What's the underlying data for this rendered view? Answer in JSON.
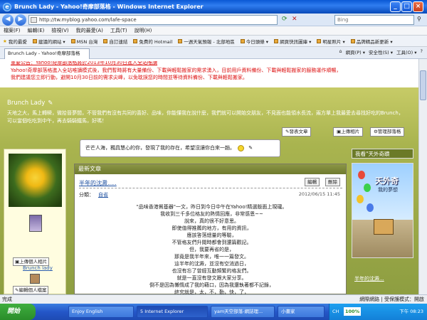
{
  "window": {
    "title": "Brunch Lady - Yahoo!奇摩部落格 - Windows Internet Explorer",
    "minimize": "_",
    "maximize": "□",
    "close": "×"
  },
  "address": {
    "url": "http://tw.myblog.yahoo.com/lafe-space",
    "search_placeholder": "Bing"
  },
  "menu": [
    "檔案(F)",
    "編輯(E)",
    "檢視(V)",
    "我的最愛(A)",
    "工具(T)",
    "說明(H)"
  ],
  "favorites": [
    "我的最愛",
    "建議的網站 ▾",
    "MSN 台灣",
    "自訂連結",
    "免費的 Hotmail",
    "一週天氣預報 - 北部地區",
    "今日頭條 ▾",
    "網頁快訊圖庫 ▾",
    "明星照片 ▾",
    "品牌精品新更新 ▾"
  ],
  "tab": {
    "label": "Brunch Lady - Yahoo!奇摩部落格"
  },
  "tools": [
    "網頁(P) ▾",
    "安全性(S) ▾",
    "工具(O) ▾",
    "?"
  ],
  "notice": {
    "line0": "重要公告：Yahoo!奇摩部落格將於2013年10月30日進入全站唯讀",
    "line1": "Yahoo!奇摩部落格進入全站唯讀模式後，我們暫時將有大量備份、下載與輕鬆搬家的需求湧入，目前用戶資料備份、下載與輕鬆搬家的服務運作順暢，",
    "line2": "我們建議您立即行動，避開10月30日前的需求尖峰，以免耽誤您的時間並等待資料備份、下載與輕鬆搬家。"
  },
  "profile": {
    "blog_title": "Brunch Lady",
    "description": "天地之大，馬上轉瞬，微拾晉夢間，不管我們有沒有共同的喜好、品味，你能懂我在說什麼，我們就可以開始交朋友，不見面也能領水長流，兩方單上我最愛去尋找好吃的Brunch，可以當個吃吃到中午，再去騎騎鐵馬，好嗎！",
    "btn_post": "發表文章",
    "btn_upload": "上傳相片",
    "btn_manage": "管理部落格",
    "bubble": "芒芒人海，獨具慧心的你，發現了我的存在，希望沒讓你白來一趟。"
  },
  "left": {
    "upload_photo": "上傳個人相片",
    "user_link": "Brunch lady",
    "edit_profile": "編輯個人檔案"
  },
  "main": {
    "section_title": "最新文章",
    "post_title": "半年的沈澱.....",
    "edit": "編輯",
    "delete": "刪除",
    "category_label": "分類：",
    "category": "自省",
    "date": "2012/06/15 11:45",
    "body": [
      "\"品味香港貧基器\"一文，昨日到今日中午在Yahoo!精選版面上現瓏。",
      "我收到三千多位格友的熱情回應，非常感恩~~",
      "說來，真的很不好意思。",
      "即使值得推薦的地方，有用的資訊，",
      "應該答落總量的等驗，",
      "不管格友們升閱時都會到還篇觀記。",
      "但，我要再省的是，",
      "那竟是我半年來，唯一一篇發文。",
      "這半年的沈澱，並沒有空消過日，",
      "也沒有忘了曾經互動頻繁的格友們。",
      "就是一直沒有發文跟大家分享。",
      "倒不是因為懶惰成了我的藉口，因為我還執著都不記錄，",
      "終究就是，太，不，勤，快，了，",
      "終於讓文格失去可以耐過激動，尋求我，亦是聲鏈，"
    ]
  },
  "right": {
    "head": "我看\"天外奇蹟",
    "poster_title": "天外奇",
    "poster_sub": "我的夢想",
    "link": "半年的沈澱..."
  },
  "status": {
    "left": "完成",
    "right": "網際網路 | 受保護模式：開啟"
  },
  "taskbar": {
    "start": "開始",
    "tasks": [
      "Enjoy English",
      "5 Internet Explorer",
      "yam天空部落-網誌理...",
      "小畫家"
    ],
    "lang": "CH",
    "battery": "100%",
    "clock": "下午 08:23"
  }
}
